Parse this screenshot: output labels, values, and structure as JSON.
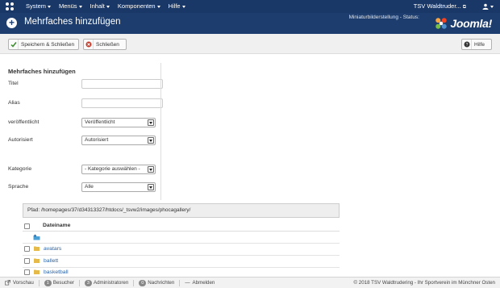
{
  "navbar": {
    "menu": [
      "System",
      "Menüs",
      "Inhalt",
      "Komponenten",
      "Hilfe"
    ],
    "site_name": "TSV Waldtruder...",
    "user_icon": "user-icon",
    "bg_color": "#1a3867"
  },
  "header": {
    "title": "Mehrfaches hinzufügen",
    "thumb_status": "Miniaturbilderstellung - Status:",
    "brand": "Joomla!",
    "bg_color": "#1c3d6e"
  },
  "toolbar": {
    "save_close_label": "Speichern & Schließen",
    "close_label": "Schließen",
    "help_label": "Hilfe"
  },
  "form": {
    "section_title": "Mehrfaches hinzufügen",
    "title_label": "Titel",
    "title_value": "",
    "alias_label": "Alias",
    "alias_value": "",
    "published_label": "veröffentlicht",
    "published_value": "Veröffentlicht",
    "approved_label": "Autorisiert",
    "approved_value": "Autorisiert",
    "category_label": "Kategorie",
    "category_value": "- Kategorie auswählen -",
    "language_label": "Sprache",
    "language_value": "Alle"
  },
  "filebrowser": {
    "path": "Pfad: /homepages/37/d34313327/htdocs/_tsvw2/images/phocagallery/",
    "column_name": "Dateiname",
    "rows": [
      "avatars",
      "ballett",
      "basketball"
    ]
  },
  "statusbar": {
    "preview": "Vorschau",
    "visitors_count": "1",
    "visitors_label": "Besucher",
    "admins_count": "3",
    "admins_label": "Administratoren",
    "messages_count": "0",
    "messages_label": "Nachrichten",
    "logout": "Abmelden",
    "copyright": "© 2018 TSV Waldtrudering - Ihr Sportverein im Münchner Osten"
  }
}
